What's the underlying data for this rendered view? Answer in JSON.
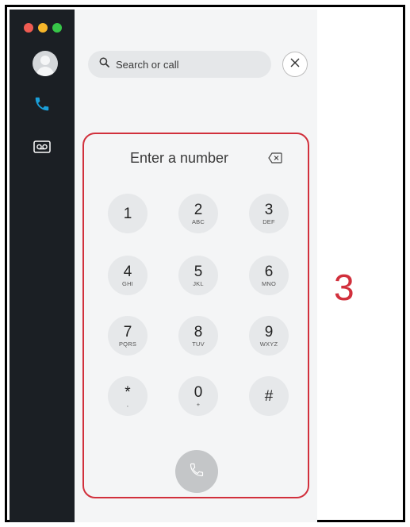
{
  "sidebar": {
    "traffic_lights": [
      "close",
      "minimize",
      "maximize"
    ],
    "items": [
      {
        "name": "avatar",
        "icon": "profile-avatar-icon"
      },
      {
        "name": "calls",
        "icon": "phone-icon",
        "color": "#1a9fd9"
      },
      {
        "name": "voicemail",
        "icon": "voicemail-icon"
      }
    ]
  },
  "search": {
    "placeholder": "Search or call",
    "icon": "search-icon",
    "close_icon": "close-icon"
  },
  "dialpad": {
    "display_placeholder": "Enter a number",
    "backspace_icon": "backspace-icon",
    "keys": [
      {
        "digit": "1",
        "letters": ""
      },
      {
        "digit": "2",
        "letters": "ABC"
      },
      {
        "digit": "3",
        "letters": "DEF"
      },
      {
        "digit": "4",
        "letters": "GHI"
      },
      {
        "digit": "5",
        "letters": "JKL"
      },
      {
        "digit": "6",
        "letters": "MNO"
      },
      {
        "digit": "7",
        "letters": "PQRS"
      },
      {
        "digit": "8",
        "letters": "TUV"
      },
      {
        "digit": "9",
        "letters": "WXYZ"
      },
      {
        "digit": "*",
        "letters": ","
      },
      {
        "digit": "0",
        "letters": "+"
      },
      {
        "digit": "#",
        "letters": ""
      }
    ],
    "call_icon": "phone-icon"
  },
  "annotation": {
    "step_label": "3",
    "color": "#d1303c"
  }
}
